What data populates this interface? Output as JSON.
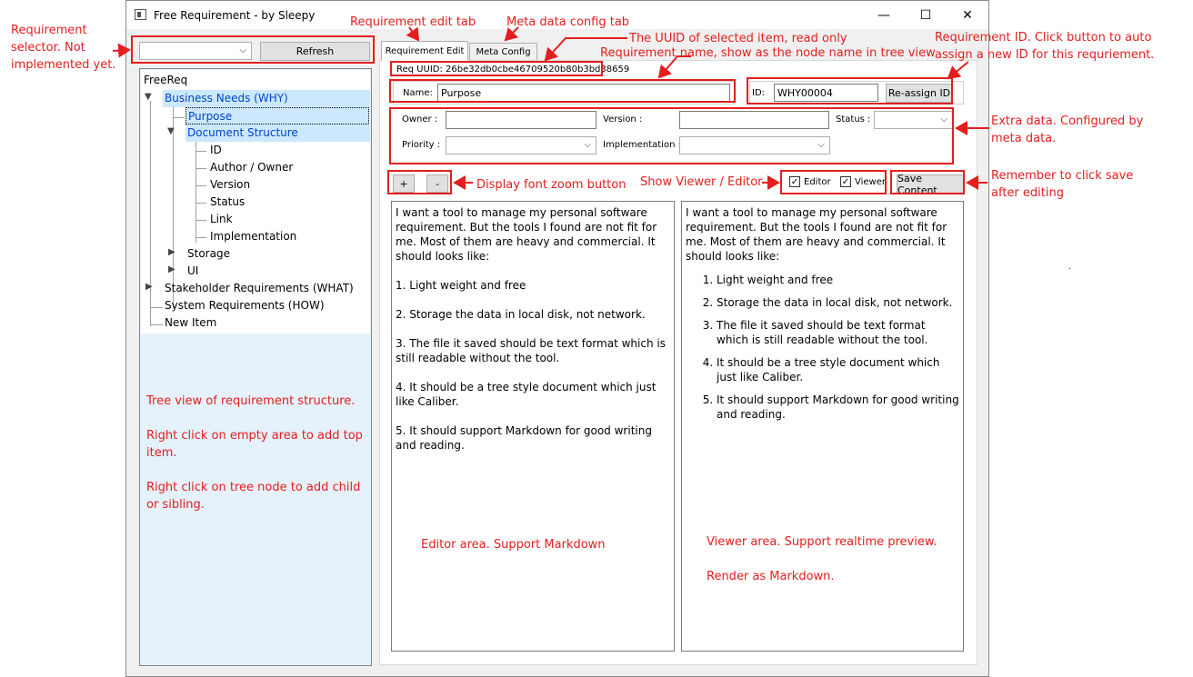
{
  "window": {
    "title": "Free Requirement - by Sleepy",
    "minimize_glyph": "—",
    "maximize_glyph": "☐",
    "close_glyph": "✕"
  },
  "left_panel": {
    "selector_value": "",
    "refresh_label": "Refresh",
    "tree": {
      "root": "FreeReq",
      "nodes": [
        {
          "label": "Business Needs (WHY)"
        },
        {
          "label": "Purpose"
        },
        {
          "label": "Document Structure"
        },
        {
          "label": "ID"
        },
        {
          "label": "Author / Owner"
        },
        {
          "label": "Version"
        },
        {
          "label": "Status"
        },
        {
          "label": "Link"
        },
        {
          "label": "Implementation"
        },
        {
          "label": "Storage"
        },
        {
          "label": "UI"
        },
        {
          "label": "Stakeholder Requirements (WHAT)"
        },
        {
          "label": "System Requirements (HOW)"
        },
        {
          "label": "New Item"
        }
      ]
    }
  },
  "tabs": [
    {
      "label": "Requirement Edit",
      "active": true
    },
    {
      "label": "Meta Config",
      "active": false
    }
  ],
  "editor": {
    "uuid_label": "Req UUID: 26be32db0cbe46709520b80b3bd38659",
    "name_label": "Name:",
    "name_value": "Purpose",
    "id_label": "ID:",
    "id_value": "WHY00004",
    "reassign_label": "Re-assign ID",
    "meta": {
      "owner_label": "Owner :",
      "owner_value": "",
      "version_label": "Version :",
      "version_value": "",
      "status_label": "Status :",
      "status_value": "",
      "priority_label": "Priority :",
      "priority_value": "",
      "implementation_label": "Implementation :",
      "implementation_value": ""
    },
    "zoom_in_label": "+",
    "zoom_out_label": "-",
    "editor_toggle_label": "Editor",
    "viewer_toggle_label": "Viewer",
    "editor_checked": true,
    "viewer_checked": true,
    "save_label": "Save Content",
    "content": {
      "intro": "I want a tool to manage my personal software requirement. But the tools I found are not fit for me. Most of them are heavy and commercial. It should looks like:",
      "items": [
        "Light weight and free",
        "Storage the data in local disk, not network.",
        "The file it saved should be text format which is still readable without the tool.",
        "It should be a tree style document which just like Caliber.",
        "It should support Markdown for good writing and reading."
      ],
      "editor_items": [
        "1. Light weight and free",
        "2. Storage the data in local disk, not network.",
        "3. The file it saved should be text format which is still readable without the tool.",
        "4. It should be a tree style document which just like Caliber.",
        "5. It should support Markdown for good writing and reading."
      ]
    }
  },
  "annotations": {
    "selector": "Requirement selector. Not implemented yet.",
    "edit_tab": "Requirement edit tab",
    "meta_tab": "Meta data config tab",
    "uuid": "The UUID of selected item, read only",
    "name": "Requirement name, show as the node name in tree view",
    "id": "Requirement ID. Click button to auto assign a new ID for this requriement.",
    "extra": "Extra data. Configured by meta data.",
    "zoom": "Display font zoom button",
    "toggle": "Show Viewer / Editor",
    "save": "Remember to click save after editing",
    "tree_1": "Tree view of requirement structure.",
    "tree_2": "Right click on empty area to add top item.",
    "tree_3": "Right click on tree node to add child or sibling.",
    "editor_area": "Editor area. Support Markdown",
    "viewer_area_1": "Viewer area. Support realtime preview.",
    "viewer_area_2": "Render as Markdown.",
    "stray_dot": "."
  }
}
